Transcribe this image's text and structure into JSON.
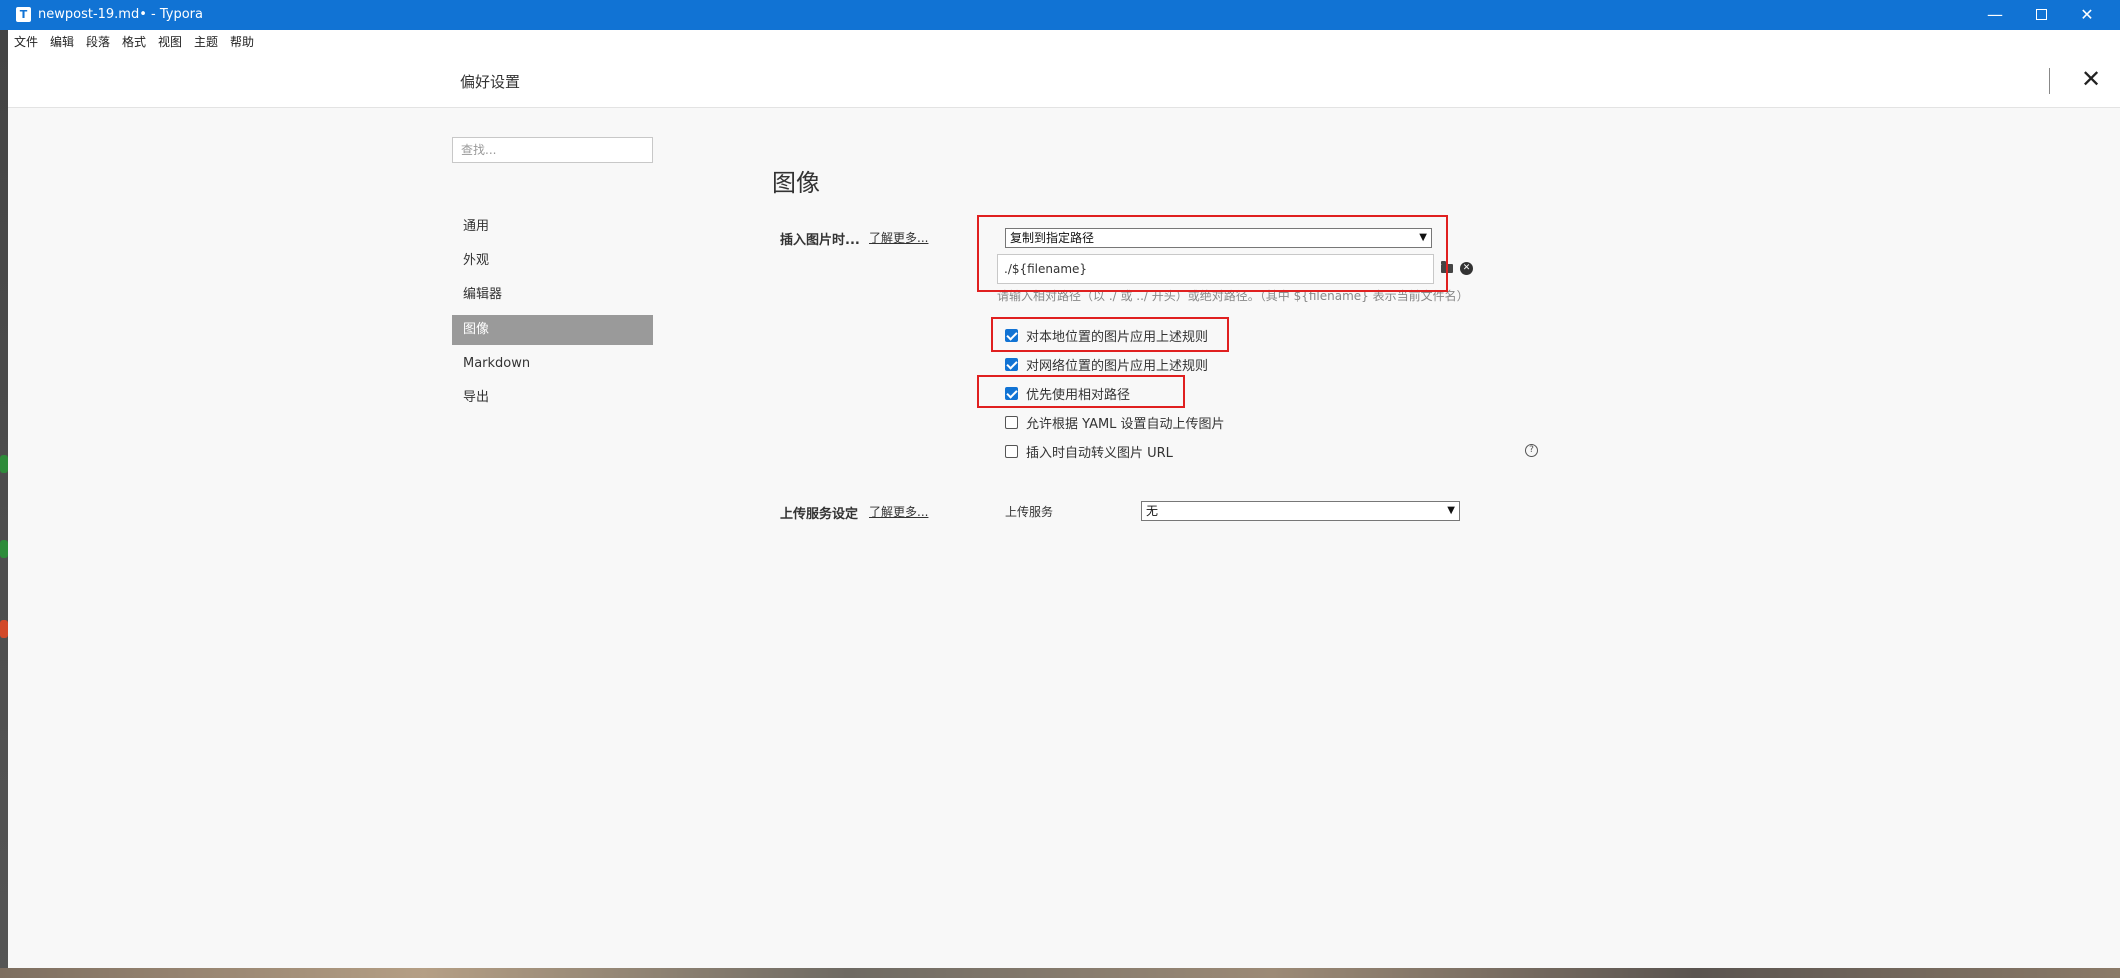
{
  "window": {
    "title": "newpost-19.md• - Typora",
    "app_icon_letter": "T",
    "controls": {
      "minimize": "—",
      "maximize": "",
      "close": "✕"
    }
  },
  "menubar": {
    "items": [
      "文件",
      "编辑",
      "段落",
      "格式",
      "视图",
      "主题",
      "帮助"
    ]
  },
  "preferences": {
    "title": "偏好设置",
    "close": "✕",
    "search_placeholder": "查找...",
    "sidebar": [
      {
        "label": "通用",
        "active": false
      },
      {
        "label": "外观",
        "active": false
      },
      {
        "label": "编辑器",
        "active": false
      },
      {
        "label": "图像",
        "active": true
      },
      {
        "label": "Markdown",
        "active": false
      },
      {
        "label": "导出",
        "active": false
      }
    ]
  },
  "image_section": {
    "title": "图像",
    "insert": {
      "label": "插入图片时...",
      "learn_more": "了解更多...",
      "action_selected": "复制到指定路径",
      "path_value": "./${filename}",
      "hint": "请输入相对路径（以 ./ 或 ../ 开头）或绝对路径。（其中 ${filename} 表示当前文件名）"
    },
    "options": [
      {
        "label": "对本地位置的图片应用上述规则",
        "checked": true
      },
      {
        "label": "对网络位置的图片应用上述规则",
        "checked": true
      },
      {
        "label": "优先使用相对路径",
        "checked": true
      },
      {
        "label": "允许根据 YAML 设置自动上传图片",
        "checked": false
      },
      {
        "label": "插入时自动转义图片 URL",
        "checked": false
      }
    ],
    "help": "?",
    "upload": {
      "label": "上传服务设定",
      "learn_more": "了解更多...",
      "service_label": "上传服务",
      "service_selected": "无"
    }
  },
  "icons": {
    "folder": "folder-icon",
    "clear": "clear-circle-icon",
    "help": "help-circle-icon"
  },
  "colors": {
    "titlebar": "#1173d4",
    "sidebar_active": "#9a9a9a",
    "annotation": "#e02020",
    "checkbox_checked": "#1173d4"
  }
}
